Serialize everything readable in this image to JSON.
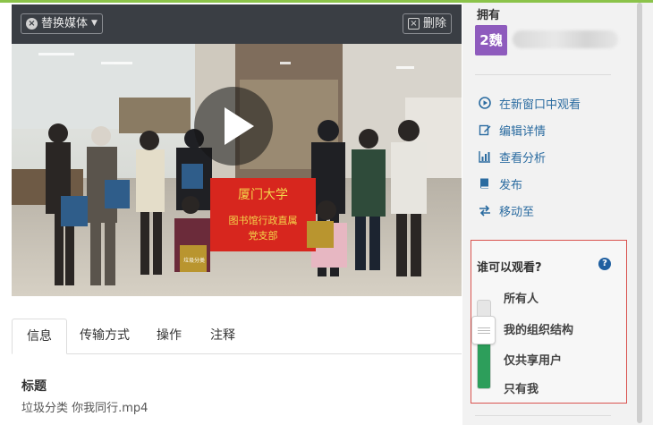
{
  "player": {
    "replace_label": "替换媒体",
    "delete_label": "删除",
    "banner_line1": "厦门大学",
    "banner_line2": "图书馆行政直属",
    "banner_line3": "党支部",
    "sign_text": "垃圾分类"
  },
  "tabs": [
    {
      "label": "信息"
    },
    {
      "label": "传输方式"
    },
    {
      "label": "操作"
    },
    {
      "label": "注释"
    }
  ],
  "metadata": {
    "title_label": "标题",
    "title_value": "垃圾分类 你我同行.mp4"
  },
  "owner": {
    "label": "拥有",
    "avatar_text": "2魏"
  },
  "actions": [
    {
      "label": "在新窗口中观看",
      "icon": "play-circle-icon"
    },
    {
      "label": "编辑详情",
      "icon": "edit-icon"
    },
    {
      "label": "查看分析",
      "icon": "chart-icon"
    },
    {
      "label": "发布",
      "icon": "book-icon"
    },
    {
      "label": "移动至",
      "icon": "move-icon"
    }
  ],
  "visibility": {
    "title": "谁可以观看?",
    "help_symbol": "?",
    "options": [
      "所有人",
      "我的组织结构",
      "仅共享用户",
      "只有我"
    ],
    "selected": "我的组织结构",
    "level": 0.75,
    "accent_color": "#2d9e5b"
  },
  "colors": {
    "link": "#2a6ba0",
    "avatar_bg": "#8e5bbd",
    "highlight_border": "#d9534f"
  }
}
